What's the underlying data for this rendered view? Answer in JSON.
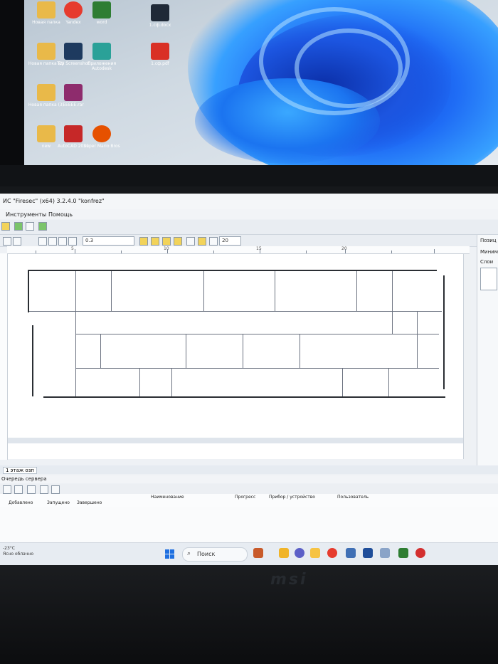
{
  "desktop": {
    "icons": [
      {
        "label": "Новая папка",
        "icon": "folder-icon",
        "color": "#e9b949"
      },
      {
        "label": "Yandex",
        "icon": "yandex-browser-icon",
        "color": "#e63b2e"
      },
      {
        "label": "word",
        "icon": "word-icon",
        "color": "#2e7d32"
      },
      {
        "label": "1.сф.docx",
        "icon": "document-icon",
        "color": "#1f2937"
      },
      {
        "label": "Новая папка (2)",
        "icon": "folder-icon",
        "color": "#e9b949"
      },
      {
        "label": "Top Screenshot",
        "icon": "camera-icon",
        "color": "#1e3a5f"
      },
      {
        "label": "Приложения Autodesk",
        "icon": "autodesk-icon",
        "color": "#2aa198"
      },
      {
        "label": "1.сф.pdf",
        "icon": "pdf-icon",
        "color": "#d93025"
      },
      {
        "label": "Новая папка (3)",
        "icon": "folder-icon",
        "color": "#e9b949"
      },
      {
        "label": "ЕЕЕЕЕ.rar",
        "icon": "winrar-icon",
        "color": "#8e2c6d"
      },
      {
        "label": "new",
        "icon": "folder-icon",
        "color": "#e9b949"
      },
      {
        "label": "AutoCAD 2021",
        "icon": "autocad-icon",
        "color": "#c62828"
      },
      {
        "label": "Super Mario Bros",
        "icon": "game-icon",
        "color": "#e65100"
      }
    ]
  },
  "app": {
    "title": "ИС \"Firesec\" (x64) 3.2.4.0 \"konfrez\"",
    "menu": [
      "Инструменты",
      "Помощь"
    ],
    "zoom_value": "0.3",
    "grid_value": "20",
    "ruler_labels": [
      "5",
      "10",
      "15",
      "20"
    ],
    "right_panel": {
      "position_label": "Позиц",
      "mini_label": "Миним",
      "layers_label": "Слои"
    },
    "floor_tab": "1 этаж озп",
    "queue": {
      "title": "Очередь сервера",
      "columns": [
        "Добавлено",
        "Запущено",
        "Завершено",
        "Наименование",
        "Прогресс",
        "Прибор / устройство",
        "Пользователь"
      ]
    }
  },
  "taskbar": {
    "weather": "-23°C",
    "weather_sub": "Ясно облачно",
    "search_placeholder": "Поиск",
    "apps": [
      {
        "name": "city-app-icon",
        "color": "#c85a2a"
      },
      {
        "name": "file-explorer-icon",
        "color": "#f0b429"
      },
      {
        "name": "chat-icon",
        "color": "#5b5fc7"
      },
      {
        "name": "folder-app-icon",
        "color": "#f6c343"
      },
      {
        "name": "yandex-taskbar-icon",
        "color": "#e63b2e"
      },
      {
        "name": "monitor-app-icon",
        "color": "#3f6fb5"
      },
      {
        "name": "mail-app-icon",
        "color": "#1f4e9a"
      },
      {
        "name": "calendar-app-icon",
        "color": "#8aa4c8"
      },
      {
        "name": "autocad-taskbar-icon",
        "color": "#2e7d32"
      },
      {
        "name": "yandex-taskbar-icon-2",
        "color": "#d32f2f"
      }
    ]
  },
  "laptop": {
    "brand": "msi"
  }
}
